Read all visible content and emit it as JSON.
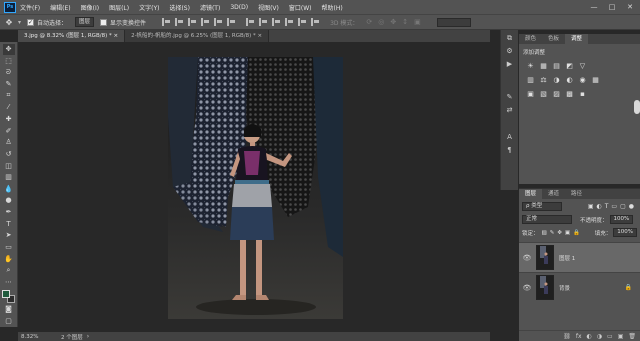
{
  "menubar": {
    "logo": "Ps",
    "items": [
      "文件(F)",
      "编辑(E)",
      "图像(I)",
      "图层(L)",
      "文字(Y)",
      "选择(S)",
      "滤镜(T)",
      "3D(D)",
      "视图(V)",
      "窗口(W)",
      "帮助(H)"
    ],
    "window_controls": [
      "—",
      "□",
      "✕"
    ]
  },
  "options": {
    "auto_select_label": "自动选择：",
    "auto_select_value": "图层",
    "show_transform_label": "显示变换控件",
    "mode_3d_label": "3D 模式："
  },
  "tabs": [
    {
      "label": "3.jpg @ 8.32% (图层 1, RGB/8) *  ×",
      "active": true
    },
    {
      "label": "2-帆船的-帆船的.jpg @ 6.25% (图层 1, RGB/8) *  ×",
      "active": false
    }
  ],
  "status": {
    "zoom": "8.32%",
    "info": "2 个图层"
  },
  "adjustments_panel": {
    "tabs": [
      "颜色",
      "色板",
      "调整"
    ],
    "active_tab": 2,
    "title": "添加调整",
    "row1": [
      "☀",
      "▦",
      "▤",
      "◩",
      "▽"
    ],
    "row2": [
      "▥",
      "⚖",
      "◑",
      "◐",
      "◉",
      "▦"
    ],
    "row3": [
      "▣",
      "▧",
      "▨",
      "▩",
      "▪"
    ]
  },
  "layers_panel": {
    "tabs": [
      "图层",
      "通道",
      "路径"
    ],
    "active_tab": 0,
    "filter_label": "ρ 类型",
    "blend_mode": "正常",
    "opacity_label": "不透明度：",
    "opacity_value": "100%",
    "lock_label": "锁定：",
    "fill_label": "填充：",
    "fill_value": "100%",
    "layers": [
      {
        "name": "图层 1",
        "selected": true
      },
      {
        "name": "背景",
        "selected": false
      }
    ],
    "footer_icons": [
      "⛓",
      "fx",
      "◐",
      "◑",
      "▭",
      "▣",
      "🗑"
    ]
  },
  "colors": {
    "ui_dark": "#535353",
    "canvas_bg": "#282828",
    "accent": "#31a8ff"
  }
}
